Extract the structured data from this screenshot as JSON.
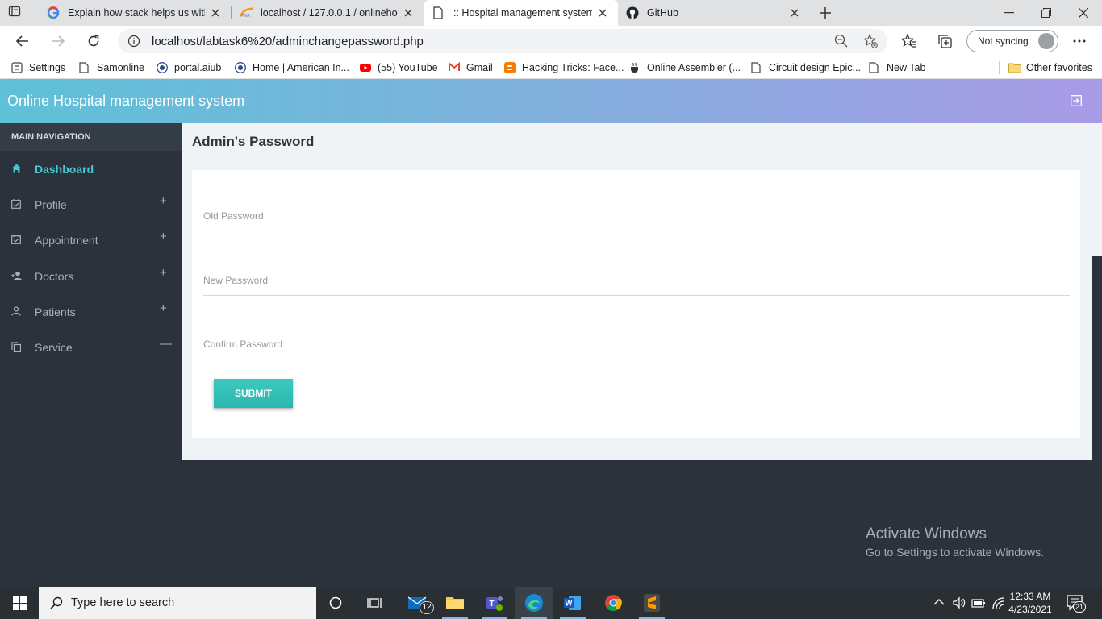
{
  "browser": {
    "tabs": [
      {
        "title": "Explain how stack helps us with p",
        "icon": "google-icon"
      },
      {
        "title": "localhost / 127.0.0.1 / onlinehosp",
        "icon": "phpmyadmin-icon"
      },
      {
        "title": ":: Hospital management system-",
        "icon": "page-icon"
      },
      {
        "title": "GitHub",
        "icon": "github-icon"
      }
    ],
    "url": "localhost/labtask6%20/adminchangepassword.php",
    "sync_label": "Not syncing",
    "bookmarks": [
      {
        "label": "Settings",
        "icon": "settings-icon"
      },
      {
        "label": "Samonline",
        "icon": "page-icon"
      },
      {
        "label": "portal.aiub",
        "icon": "aiub-icon"
      },
      {
        "label": "Home | American In...",
        "icon": "aiub-icon"
      },
      {
        "label": "(55) YouTube",
        "icon": "youtube-icon"
      },
      {
        "label": "Gmail",
        "icon": "gmail-icon"
      },
      {
        "label": "Hacking Tricks: Face...",
        "icon": "blogger-icon"
      },
      {
        "label": "Online Assembler (...",
        "icon": "cup-icon"
      },
      {
        "label": "Circuit design Epic...",
        "icon": "page-icon"
      },
      {
        "label": "New Tab",
        "icon": "page-icon"
      }
    ],
    "other_favorites": "Other favorites"
  },
  "app": {
    "title": "Online Hospital management system",
    "sidebar": {
      "heading": "MAIN NAVIGATION",
      "items": [
        {
          "label": "Dashboard",
          "icon": "home-icon",
          "toggle": ""
        },
        {
          "label": "Profile",
          "icon": "calendar-check-icon",
          "toggle": "+"
        },
        {
          "label": "Appointment",
          "icon": "calendar-check-icon",
          "toggle": "+"
        },
        {
          "label": "Doctors",
          "icon": "user-plus-icon",
          "toggle": "+"
        },
        {
          "label": "Patients",
          "icon": "user-icon",
          "toggle": "+"
        },
        {
          "label": "Service",
          "icon": "copy-icon",
          "toggle": "—"
        }
      ]
    },
    "page_title": "Admin's Password",
    "form": {
      "old_placeholder": "Old Password",
      "new_placeholder": "New Password",
      "confirm_placeholder": "Confirm Password",
      "submit_label": "SUBMIT"
    }
  },
  "watermark": {
    "line1": "Activate Windows",
    "line2": "Go to Settings to activate Windows."
  },
  "taskbar": {
    "search_placeholder": "Type here to search",
    "mail_badge": "12",
    "time": "12:33 AM",
    "date": "4/23/2021",
    "notifications": "21"
  },
  "colors": {
    "accent": "#45c8d2",
    "submit": "#2fbdb3",
    "sidebar": "#2b323b",
    "header_start": "#5ec1d8",
    "header_end": "#a99ae6"
  }
}
